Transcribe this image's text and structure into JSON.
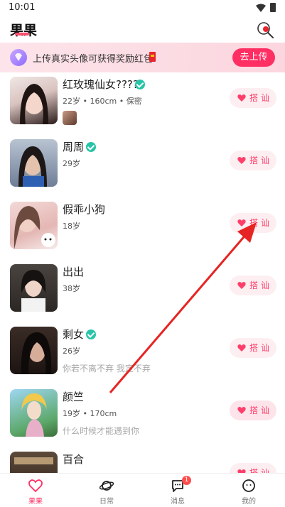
{
  "status_bar": {
    "time": "10:01"
  },
  "header": {
    "title": "果果"
  },
  "banner": {
    "text": "上传真实头像可获得奖励红包",
    "button_label": "去上传"
  },
  "users": [
    {
      "name": "红玫瑰仙女????",
      "verified": true,
      "meta": "22岁 • 160cm • 保密",
      "bio": "",
      "has_photo_thumb": true,
      "action_label": "搭 讪"
    },
    {
      "name": "周周",
      "verified": true,
      "meta": "29岁",
      "bio": "",
      "has_photo_thumb": false,
      "action_label": "搭 讪"
    },
    {
      "name": "假乖小狗",
      "verified": false,
      "meta": "18岁",
      "bio": "",
      "has_photo_thumb": false,
      "action_label": "搭 讪"
    },
    {
      "name": "出出",
      "verified": false,
      "meta": "38岁",
      "bio": "",
      "has_photo_thumb": false,
      "action_label": "搭 讪"
    },
    {
      "name": "剩女",
      "verified": true,
      "meta": "26岁",
      "bio": "你若不离不弃 我定不弃",
      "has_photo_thumb": false,
      "action_label": "搭 讪"
    },
    {
      "name": "颜竺",
      "verified": false,
      "meta": "19岁 • 170cm",
      "bio": "什么时候才能遇到你",
      "has_photo_thumb": false,
      "action_label": "搭 讪"
    },
    {
      "name": "百合",
      "verified": false,
      "meta": "",
      "bio": "",
      "has_photo_thumb": false,
      "action_label": "搭 讪"
    }
  ],
  "tabbar": {
    "items": [
      {
        "label": "果果",
        "icon": "heart-icon",
        "active": true
      },
      {
        "label": "日常",
        "icon": "planet-icon",
        "active": false
      },
      {
        "label": "消息",
        "icon": "message-icon",
        "active": false,
        "badge": "1"
      },
      {
        "label": "我的",
        "icon": "profile-icon",
        "active": false
      }
    ]
  },
  "colors": {
    "accent": "#ff2e63",
    "verified": "#27c4a8",
    "chat_button_bg": "#fdeef1"
  }
}
